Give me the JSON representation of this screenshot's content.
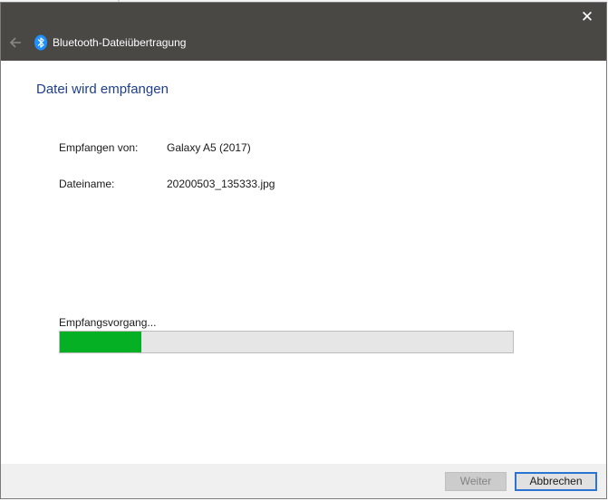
{
  "window": {
    "title": "Bluetooth-Dateiübertragung",
    "close_glyph": "✕",
    "back_icon": "back-arrow-icon",
    "title_icon": "bluetooth-icon"
  },
  "main": {
    "heading": "Datei wird empfangen",
    "sender_label": "Empfangen von:",
    "sender_value": "Galaxy A5 (2017)",
    "filename_label": "Dateiname:",
    "filename_value": "20200503_135333.jpg",
    "progress_label": "Empfangsvorgang...",
    "progress_fraction": 0.18
  },
  "footer": {
    "next_label": "Weiter",
    "cancel_label": "Abbrechen"
  },
  "colors": {
    "titlebar": "#4a4845",
    "heading": "#1d3f8c",
    "progress": "#06b025",
    "bluetooth": "#1e90ff",
    "focus_border": "#2b74d1"
  }
}
